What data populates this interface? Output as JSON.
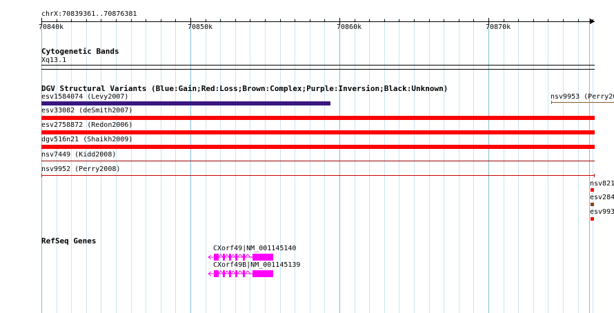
{
  "ruler": {
    "coords": "chrX:70839361..70876381",
    "ticks": [
      "70840k",
      "70850k",
      "70860k",
      "70870k"
    ]
  },
  "tracks": {
    "cytoband": {
      "title": "Cytogenetic Bands",
      "band": "Xq13.1"
    },
    "dgv": {
      "title": "DGV Structural Variants (Blue:Gain;Red:Loss;Brown:Complex;Purple:Inversion;Black:Unknown)",
      "features": [
        {
          "label": "esv1584074 (Levy2007)",
          "color": "#3b1680"
        },
        {
          "label": "esv33082 (deSmith2007)",
          "color": "#ff0000"
        },
        {
          "label": "esv2758872 (Redon2006)",
          "color": "#ff0000"
        },
        {
          "label": "dgv516n21 (Shaikh2009)",
          "color": "#ff0000"
        },
        {
          "label": "nsv7449 (Kidd2008)",
          "color": "#990000"
        },
        {
          "label": "nsv9952 (Perry2008)",
          "color": "#cc0000"
        },
        {
          "label": "nsv9953 (Perry20",
          "color": "#8b5a2b"
        },
        {
          "label": "nsv821",
          "color": "#ff0000"
        },
        {
          "label": "esv284",
          "color": "#8b4513"
        },
        {
          "label": "esv993",
          "color": "#ff0000"
        }
      ]
    },
    "refseq": {
      "title": "RefSeq Genes",
      "genes": [
        {
          "label": "CXorf49|NM_001145140"
        },
        {
          "label": "CXorf49B|NM_001145139"
        }
      ],
      "color": "#ff00ff"
    }
  }
}
